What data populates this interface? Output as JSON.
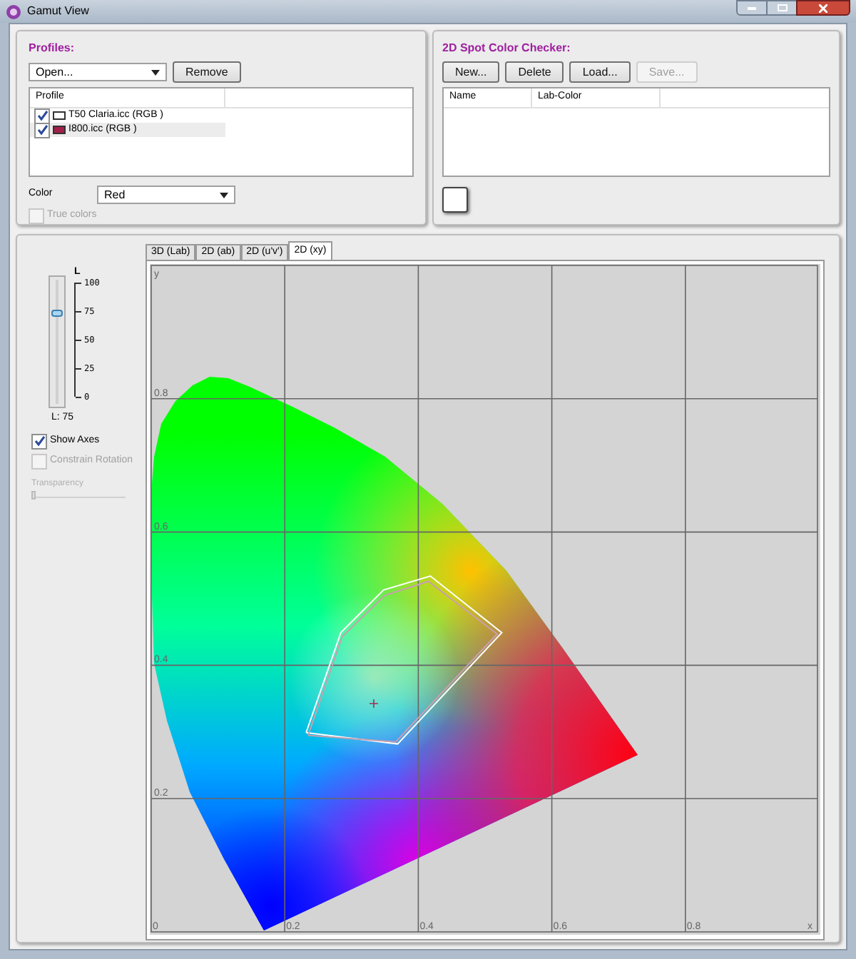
{
  "window": {
    "title": "Gamut View"
  },
  "profiles": {
    "title": "Profiles:",
    "open_dropdown": "Open...",
    "remove_button": "Remove",
    "column": "Profile",
    "items": [
      {
        "label": "T50 Claria.icc (RGB )",
        "checked": true,
        "color": "#ffffff",
        "selected": false
      },
      {
        "label": "I800.icc (RGB )",
        "checked": true,
        "color": "#a3204a",
        "selected": true
      }
    ],
    "color_label": "Color",
    "color_value": "Red",
    "true_colors": {
      "label": "True colors",
      "checked": false,
      "disabled": true
    }
  },
  "spot_checker": {
    "title": "2D Spot Color Checker:",
    "buttons": [
      {
        "label": "New...",
        "disabled": false
      },
      {
        "label": "Delete",
        "disabled": false
      },
      {
        "label": "Load...",
        "disabled": false
      },
      {
        "label": "Save...",
        "disabled": true
      }
    ],
    "columns": [
      "Name",
      "Lab-Color"
    ]
  },
  "lightness": {
    "title": "L",
    "ticks": [
      "100",
      "75",
      "50",
      "25",
      "0"
    ],
    "level": 0.75,
    "reading": "L: 75"
  },
  "options": [
    {
      "label": "Show Axes",
      "checked": true,
      "disabled": false
    },
    {
      "label": "Constrain Rotation",
      "checked": false,
      "disabled": true
    }
  ],
  "transparency": {
    "label": "Transparency",
    "level": 0,
    "disabled": true
  },
  "tabs": [
    {
      "label": "3D (Lab)",
      "selected": false
    },
    {
      "label": "2D (ab)",
      "selected": false
    },
    {
      "label": "2D (u'v')",
      "selected": false
    },
    {
      "label": "2D (xy)",
      "selected": true
    }
  ],
  "diagram": {
    "x_axis_label": "x",
    "y_axis_label": "y",
    "x_tick_labels": [
      "0",
      "0.2",
      "0.4",
      "0.6",
      "0.8"
    ],
    "y_tick_labels": [
      "0.8",
      "0.6",
      "0.4",
      "0.2"
    ]
  }
}
